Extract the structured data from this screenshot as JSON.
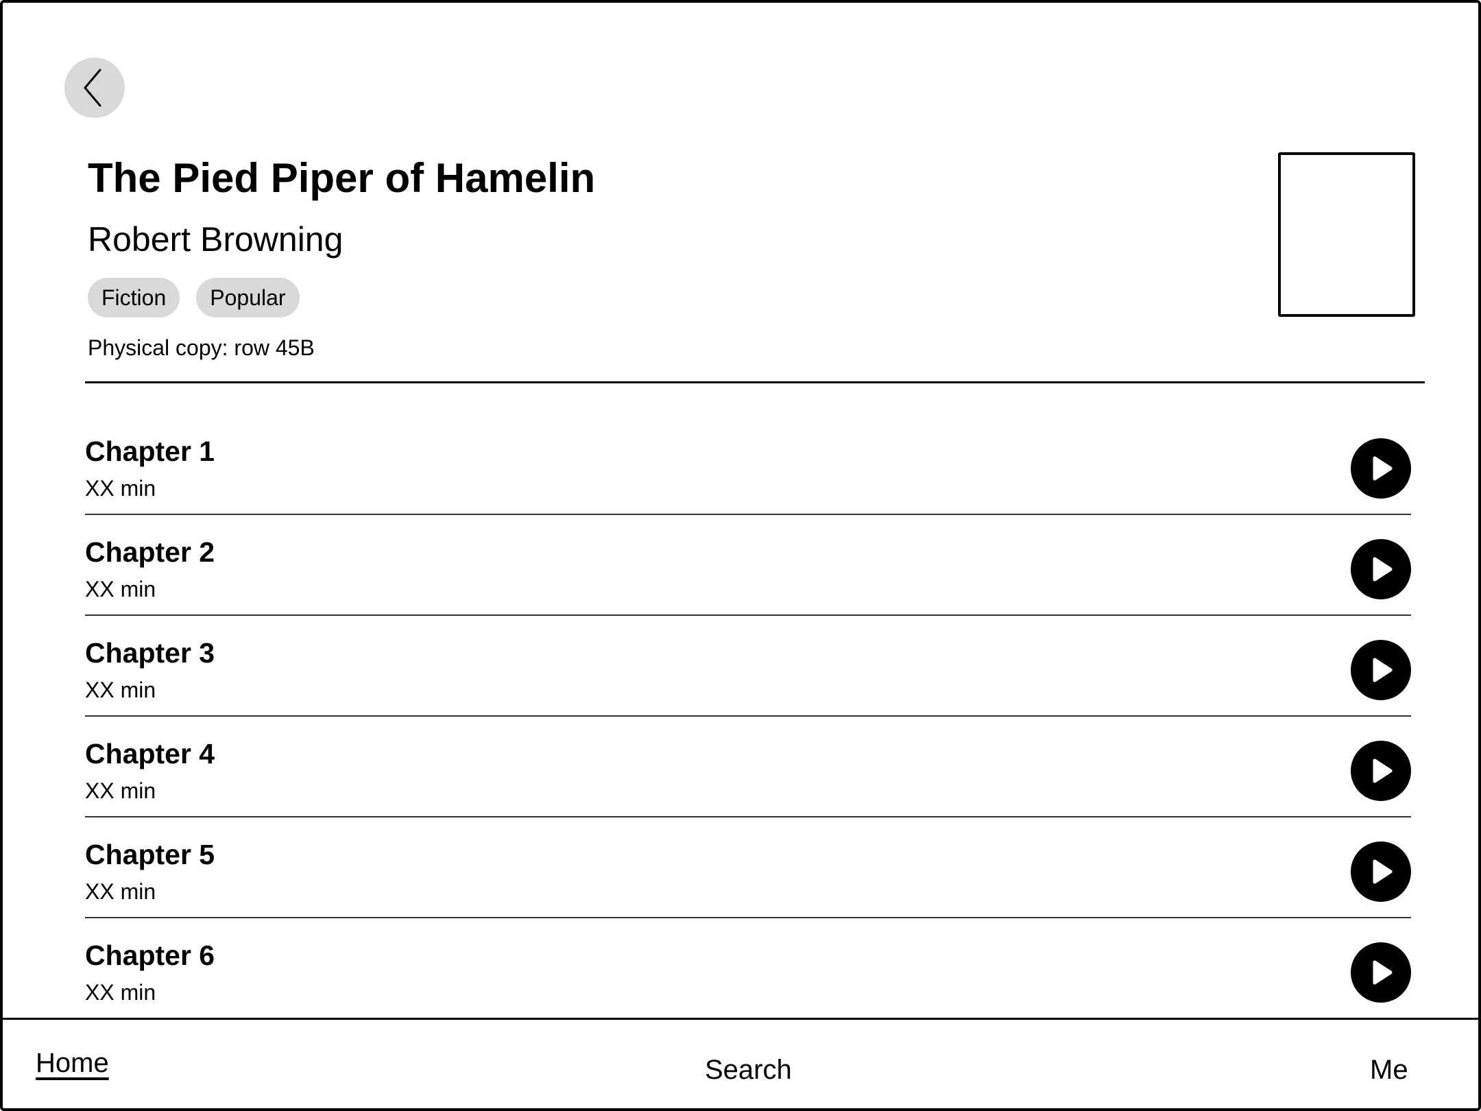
{
  "book": {
    "title": "The Pied Piper of Hamelin",
    "author": "Robert Browning",
    "tags": [
      "Fiction",
      "Popular"
    ],
    "location": "Physical copy: row 45B"
  },
  "chapters": [
    {
      "title": "Chapter 1",
      "duration": "XX min"
    },
    {
      "title": "Chapter 2",
      "duration": "XX min"
    },
    {
      "title": "Chapter 3",
      "duration": "XX min"
    },
    {
      "title": "Chapter 4",
      "duration": "XX min"
    },
    {
      "title": "Chapter 5",
      "duration": "XX min"
    },
    {
      "title": "Chapter 6",
      "duration": "XX min"
    }
  ],
  "nav": {
    "home": "Home",
    "search": "Search",
    "me": "Me",
    "active": "Home"
  },
  "icons": {
    "back": "chevron-left-icon",
    "play": "play-icon"
  },
  "colors": {
    "chip_background": "#d9d9d9",
    "back_button_background": "#d9d9d9",
    "play_button_background": "#000000"
  }
}
